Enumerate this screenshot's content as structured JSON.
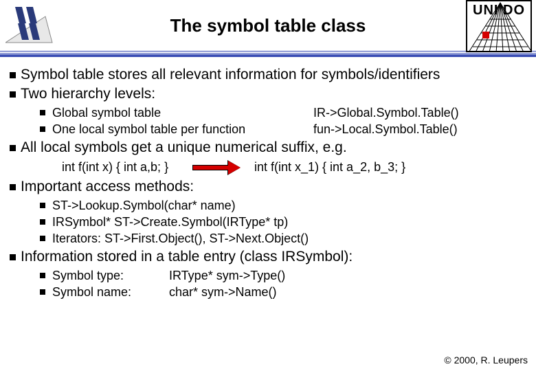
{
  "header": {
    "title": "The symbol table class",
    "right_logo_text": "UNI DO"
  },
  "bullets": {
    "b1": "Symbol table stores all relevant information for symbols/identifiers",
    "b2": "Two hierarchy levels:",
    "b2_sub": {
      "s1_left": "Global symbol table",
      "s1_right": "IR->Global.Symbol.Table()",
      "s2_left": "One local symbol table per function",
      "s2_right": "fun->Local.Symbol.Table()"
    },
    "b3": "All local symbols get a unique numerical suffix, e.g.",
    "b3_code": {
      "before": "int f(int x) { int a,b; }",
      "after": "int f(int x_1) { int a_2, b_3; }"
    },
    "b4": "Important access methods:",
    "b4_sub": {
      "s1": "ST->Lookup.Symbol(char* name)",
      "s2": "IRSymbol* ST->Create.Symbol(IRType* tp)",
      "s3": "Iterators: ST->First.Object(), ST->Next.Object()"
    },
    "b5": "Information stored in a table entry (class IRSymbol):",
    "b5_sub": {
      "s1_left": "Symbol type:",
      "s1_right": "IRType* sym->Type()",
      "s2_left": "Symbol name:",
      "s2_right": "char* sym->Name()"
    }
  },
  "footer": "© 2000, R. Leupers"
}
